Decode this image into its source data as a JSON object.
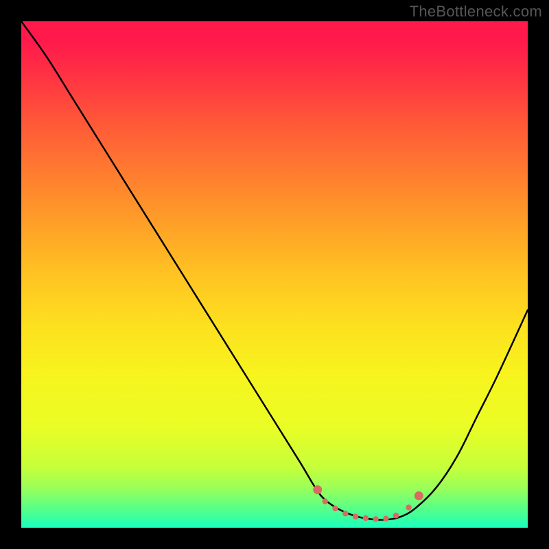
{
  "watermark": "TheBottleneck.com",
  "colors": {
    "background": "#000000",
    "curve_stroke": "#000000",
    "marker_fill": "#d96b63",
    "gradient_top": "#ff1a4b",
    "gradient_bottom": "#1affc0"
  },
  "chart_data": {
    "type": "line",
    "title": "",
    "xlabel": "",
    "ylabel": "",
    "xlim": [
      0,
      100
    ],
    "ylim": [
      0,
      100
    ],
    "grid": false,
    "legend": false,
    "series": [
      {
        "name": "bottleneck_curve",
        "x": [
          0,
          5,
          10,
          15,
          20,
          25,
          30,
          35,
          40,
          45,
          50,
          55,
          58,
          60,
          63,
          66,
          69,
          72,
          75,
          78,
          82,
          86,
          90,
          94,
          100
        ],
        "y": [
          100,
          93,
          85,
          77,
          69,
          61,
          53,
          45,
          37,
          29,
          21,
          13,
          8,
          5.5,
          3.5,
          2.3,
          1.7,
          1.6,
          2.2,
          4,
          8,
          14,
          22,
          30,
          43
        ]
      }
    ],
    "markers": [
      {
        "x": 58.5,
        "y": 7.5
      },
      {
        "x": 60,
        "y": 5.2
      },
      {
        "x": 62,
        "y": 3.8
      },
      {
        "x": 64,
        "y": 2.8
      },
      {
        "x": 66,
        "y": 2.2
      },
      {
        "x": 68,
        "y": 1.9
      },
      {
        "x": 70,
        "y": 1.7
      },
      {
        "x": 72,
        "y": 1.8
      },
      {
        "x": 74,
        "y": 2.4
      },
      {
        "x": 76.5,
        "y": 4.0
      },
      {
        "x": 78.5,
        "y": 6.3
      }
    ]
  }
}
